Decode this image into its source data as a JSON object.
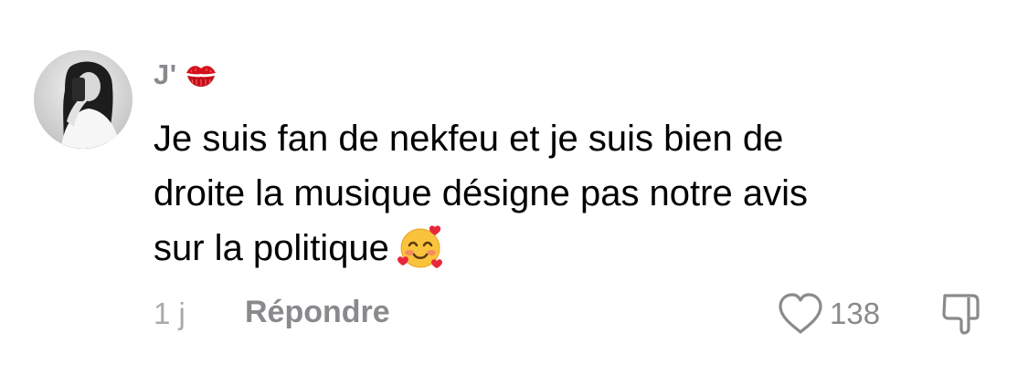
{
  "comment": {
    "username": "J'",
    "username_emoji": "kiss-mark-icon",
    "text_lines": [
      "Je suis fan de nekfeu et je suis bien de",
      "droite la musique désigne pas notre avis",
      "sur la politique"
    ],
    "text_emoji": "smiling-face-with-hearts-icon",
    "timestamp": "1 j",
    "reply_label": "Répondre",
    "like_count": "138"
  },
  "colors": {
    "text": "#000000",
    "secondary": "#8a8a8e",
    "timestamp": "#a9a9ad",
    "kiss": "#d4111b",
    "emoji_face": "#f9c33d",
    "emoji_heart": "#e8283a"
  }
}
